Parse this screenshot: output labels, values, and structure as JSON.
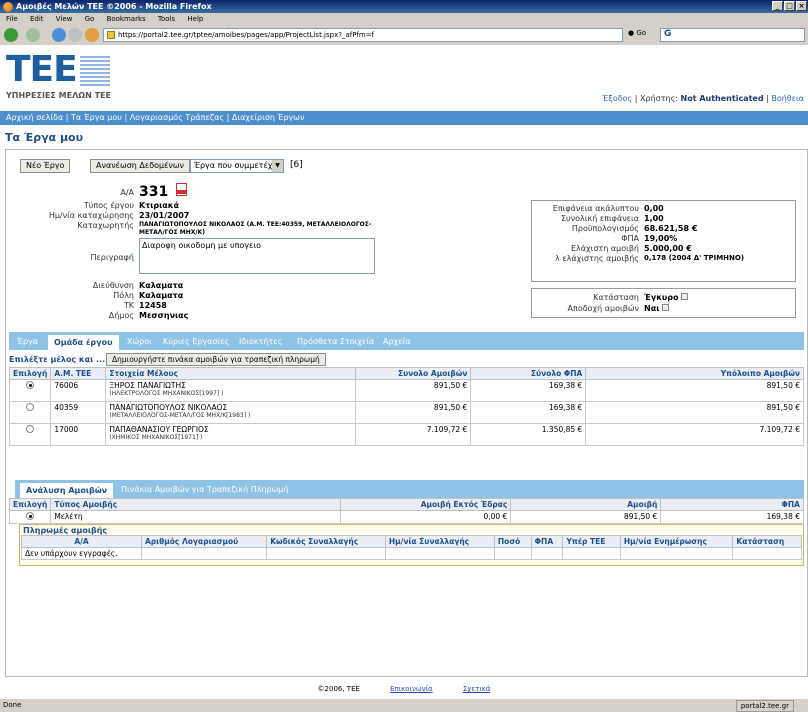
{
  "window": {
    "title": "Αμοιβές Μελών ΤΕΕ ©2006 - Mozilla Firefox"
  },
  "menu": [
    "File",
    "Edit",
    "View",
    "Go",
    "Bookmarks",
    "Tools",
    "Help"
  ],
  "address": {
    "url": "https://portal2.tee.gr/tptee/amoibes/pages/app/ProjectList.jspx?_afPfm=f",
    "go_label": "Go",
    "search_value": "G"
  },
  "header": {
    "logo_text": "TEE",
    "logo_sub": "ΥΠΗΡΕΣΙΕΣ ΜΕΛΩΝ ΤΕΕ",
    "exit": "Έξοδος",
    "user_label": "Χρήστης:",
    "user_value": "Not Authenticated",
    "help": "Βοήθεια"
  },
  "nav": [
    "Αρχική σελίδα",
    "Τα Έργα μου",
    "Λογαριασμός Τράπεζας",
    "Διαχείριση Έργων"
  ],
  "page_title": "Τα Έργα μου",
  "toolbar": {
    "new_label": "Νέο Έργο",
    "refresh_label": "Ανανέωση Δεδομένων",
    "select_value": "Έργα που συμμετέχω",
    "count": "[6]"
  },
  "project": {
    "aa_label": "Α/Α",
    "aa_value": "331",
    "type_label": "Τύπος έργου",
    "type_value": "Κτιριακά",
    "date_label": "Ημ/νία καταχώρησης",
    "date_value": "23/01/2007",
    "registrar_label": "Καταχωρητής",
    "registrar_value": "ΠΑΝΑΓΙΩΤΟΠΟΥΛΟΣ ΝΙΚΟΛΑΟΣ (Α.Μ. ΤΕΕ:40359, ΜΕΤΑΛΛΕΙΟΛΟΓΟΣ-ΜΕΤΑΛ/ΓΟΣ ΜΗΧ/Κ)",
    "desc_label": "Περιγραφή",
    "desc_value": "Διαροφη οικοδομη με υπογειο",
    "address_label": "Διεύθυνση",
    "address_value": "Καλαματα",
    "city_label": "Πόλη",
    "city_value": "Καλαματα",
    "zip_label": "ΤΚ",
    "zip_value": "12458",
    "municipality_label": "Δήμος",
    "municipality_value": "Μεσσηνιας"
  },
  "summary": {
    "area_label": "Επιφάνεια ακάλυπτου",
    "area_value": "0,00",
    "total_area_label": "Συνολική επιφάνεια",
    "total_area_value": "1,00",
    "budget_label": "Προϋπολογισμός",
    "budget_value": "68.621,58 €",
    "vat_label": "ΦΠΑ",
    "vat_value": "19,00%",
    "min_fee_label": "Ελάχιστη αμοιβή",
    "min_fee_value": "5.000,00 €",
    "lambda_label": "λ ελάχιστης αμοιβής",
    "lambda_value": "0,178 (2004 Δ' ΤΡΙΜΗΝΟ)",
    "status_label": "Κατάσταση",
    "status_value": "Έγκυρο",
    "accept_label": "Αποδοχή αμοιβών",
    "accept_value": "Ναι"
  },
  "tabs": [
    "Έργα",
    "Ομάδα έργου",
    "Χώροι",
    "Κύριες Εργασίες",
    "Ιδιοκτήτες",
    "Πρόσθετα Στοιχεία",
    "Αρχεία"
  ],
  "members": {
    "select_label": "Επιλέξτε μέλος και ...",
    "create_button": "Δημιουργήστε πινάκα αμοιβών για τραπεζική πληρωμή",
    "headers": [
      "Επιλογή",
      "Α.Μ. ΤΕΕ",
      "Στοιχεία Μέλους",
      "Συνολο Αμοιβών",
      "Σύνολο ΦΠΑ",
      "Υπόλοιπο Αμοιβών"
    ],
    "rows": [
      {
        "am": "76006",
        "name": "ΞΗΡΟΣ ΠΑΝΑΓΙΩΤΗΣ",
        "spec": "(ΗΛΕΚΤΡΟΛΟΓΟΣ ΜΗΧΑΝΙΚΟΣ[1997] )",
        "total": "891,50 €",
        "vat": "169,38 €",
        "rest": "891,50 €"
      },
      {
        "am": "40359",
        "name": "ΠΑΝΑΓΙΩΤΟΠΟΥΛΟΣ ΝΙΚΟΛΑΟΣ",
        "spec": "(ΜΕΤΑΛΛΕΙΟΛΟΓΟΣ-ΜΕΤΑΛ/ΓΟΣ ΜΗΧ/Κ[1983] )",
        "total": "891,50 €",
        "vat": "169,38 €",
        "rest": "891,50 €"
      },
      {
        "am": "17000",
        "name": "ΠΑΠΑΘΑΝΑΣΙΟΥ ΓΕΩΡΓΙΟΣ",
        "spec": "(ΧΗΜΙΚΟΣ ΜΗΧΑΝΙΚΟΣ[1971] )",
        "total": "7.109,72 €",
        "vat": "1.350,85 €",
        "rest": "7.109,72 €"
      }
    ]
  },
  "subtabs": [
    "Ανάλυση Αμοιβών",
    "Πινάκια Αμοιβών για Τραπεζική Πληρωμή"
  ],
  "fees": {
    "headers": [
      "Επιλογή",
      "Τύπος Αμοιβής",
      "Αμοιβή Εκτός Έδρας",
      "Αμοιβή",
      "ΦΠΑ"
    ],
    "row": {
      "type": "Μελέτη",
      "outside": "0,00 €",
      "fee": "891,50 €",
      "vat": "169,38 €"
    }
  },
  "payments": {
    "title": "Πληρωμές αμοιβής",
    "headers": [
      "Α/Α",
      "Αριθμός Λογαριασμού",
      "Κωδικός Συναλλαγής",
      "Ημ/νία Συναλλαγής",
      "Ποσό",
      "ΦΠΑ",
      "Υπέρ ΤΕΕ",
      "Ημ/νία Ενημέρωσης",
      "Κατάσταση"
    ],
    "empty": "Δεν υπάρχουν εγγραφές."
  },
  "footer": {
    "copyright": "©2006, ΤΕΕ",
    "contact": "Επικοινωνία",
    "about": "Σχετικά"
  },
  "status": {
    "left": "Done",
    "right": "portal2.tee.gr"
  }
}
